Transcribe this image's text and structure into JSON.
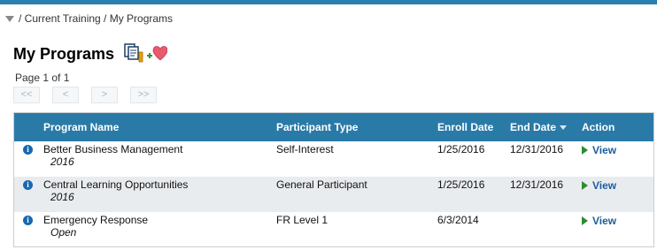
{
  "breadcrumb": {
    "text": "/ Current Training / My Programs"
  },
  "page": {
    "title": "My Programs",
    "page_count": "Page 1 of 1"
  },
  "pager": {
    "first": "<<",
    "prev": "<",
    "next": ">",
    "last": ">>"
  },
  "table": {
    "headers": {
      "program_name": "Program Name",
      "participant_type": "Participant Type",
      "enroll_date": "Enroll Date",
      "end_date": "End Date",
      "action": "Action"
    },
    "rows": [
      {
        "name": "Better Business Management",
        "sub": "2016",
        "type": "Self-Interest",
        "enroll": "1/25/2016",
        "end": "12/31/2016",
        "action": "View"
      },
      {
        "name": "Central Learning Opportunities",
        "sub": "2016",
        "type": "General Participant",
        "enroll": "1/25/2016",
        "end": "12/31/2016",
        "action": "View"
      },
      {
        "name": "Emergency Response",
        "sub": "Open",
        "type": "FR Level 1",
        "enroll": "6/3/2014",
        "end": "",
        "action": "View"
      }
    ]
  },
  "colors": {
    "header_bg": "#2a7aa7",
    "top_bar": "#2b7fae",
    "link": "#1b5e9c",
    "play": "#2e8b2e",
    "info": "#1668b0"
  },
  "icons": {
    "title_icons": [
      "copy-documents-icon",
      "add-favorite-heart-icon"
    ],
    "row_icon": "info-icon",
    "action_icon": "play-icon",
    "sort_icon": "sort-down-arrow-icon"
  }
}
